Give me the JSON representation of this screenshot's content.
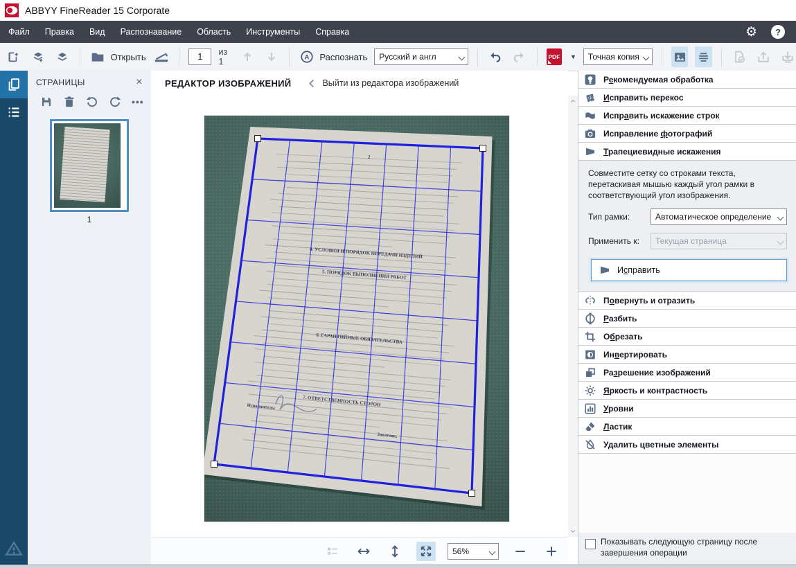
{
  "window": {
    "title": "ABBYY FineReader 15 Corporate"
  },
  "menubar": {
    "items": [
      "Файл",
      "Правка",
      "Вид",
      "Распознавание",
      "Область",
      "Инструменты",
      "Справка"
    ]
  },
  "toolbar": {
    "open_label": "Открыть",
    "page_value": "1",
    "page_of_label": "из 1",
    "recognize_label": "Распознать",
    "language_value": "Русский и англ",
    "pdf_label": "PDF",
    "mode_value": "Точная копия"
  },
  "pages_panel": {
    "title": "СТРАНИЦЫ",
    "page_number": "1"
  },
  "editor": {
    "title": "РЕДАКТОР ИЗОБРАЖЕНИЙ",
    "exit_label": "Выйти из редактора изображений",
    "zoom_value": "56%"
  },
  "photo": {
    "headings": [
      "2",
      "4. УСЛОВИЯ И ПОРЯДОК ПЕРЕДАЧИ ИЗДЕЛИЙ",
      "5. ПОРЯДОК ВЫПОЛНЕНИЯ РАБОТ",
      "6. ГАРАНТИЙНЫЕ ОБЯЗАТЕЛЬСТВА",
      "7. ОТВЕТСТВЕННОСТЬ СТОРОН",
      "Исполнитель:",
      "Заказчик:"
    ]
  },
  "right_panel": {
    "tools_top": [
      {
        "label": "Рекомендуемая обработка",
        "accel": 1,
        "icon": "lightbulb"
      },
      {
        "label": "Исправить перекос",
        "accel": 0,
        "icon": "deskew"
      },
      {
        "label": "Исправить искажение строк",
        "accel": 4,
        "icon": "wavylines"
      },
      {
        "label": "Исправление фотографий",
        "accel": 12,
        "icon": "camera"
      },
      {
        "label": "Трапециевидные искажения",
        "accel": 0,
        "icon": "trapezoid"
      }
    ],
    "trapezoid_section": {
      "instruction": "Совместите сетку со строками текста, перетаскивая мышью каждый угол рамки в соответствующий угол изображения.",
      "frame_type_label": "Тип рамки:",
      "frame_type_value": "Автоматическое определение",
      "apply_to_label": "Применить к:",
      "apply_to_value": "Текущая страница",
      "fix_button_label": "Исправить",
      "fix_button_accel": 1
    },
    "tools_bottom": [
      {
        "label": "Повернуть и отразить",
        "accel": 1,
        "icon": "rotateflip"
      },
      {
        "label": "Разбить",
        "accel": 0,
        "icon": "split"
      },
      {
        "label": "Обрезать",
        "accel": 1,
        "icon": "crop"
      },
      {
        "label": "Инвертировать",
        "accel": 2,
        "icon": "invert"
      },
      {
        "label": "Разрешение изображений",
        "accel": 2,
        "icon": "resolution"
      },
      {
        "label": "Яркость и контрастность",
        "accel": 0,
        "icon": "brightness"
      },
      {
        "label": "Уровни",
        "accel": 0,
        "icon": "levels"
      },
      {
        "label": "Ластик",
        "accel": 0,
        "icon": "eraser"
      },
      {
        "label": "Удалить цветные элементы",
        "accel": 1,
        "icon": "removecolor"
      }
    ],
    "checkbox_label": "Показывать следующую страницу после завершения операции"
  },
  "colors": {
    "accent_blue": "#2473a8",
    "grid_blue": "#2020e0",
    "pdf_red": "#c4122f",
    "rail_navy": "#1a4868",
    "menubar_gray": "#3d424c"
  }
}
